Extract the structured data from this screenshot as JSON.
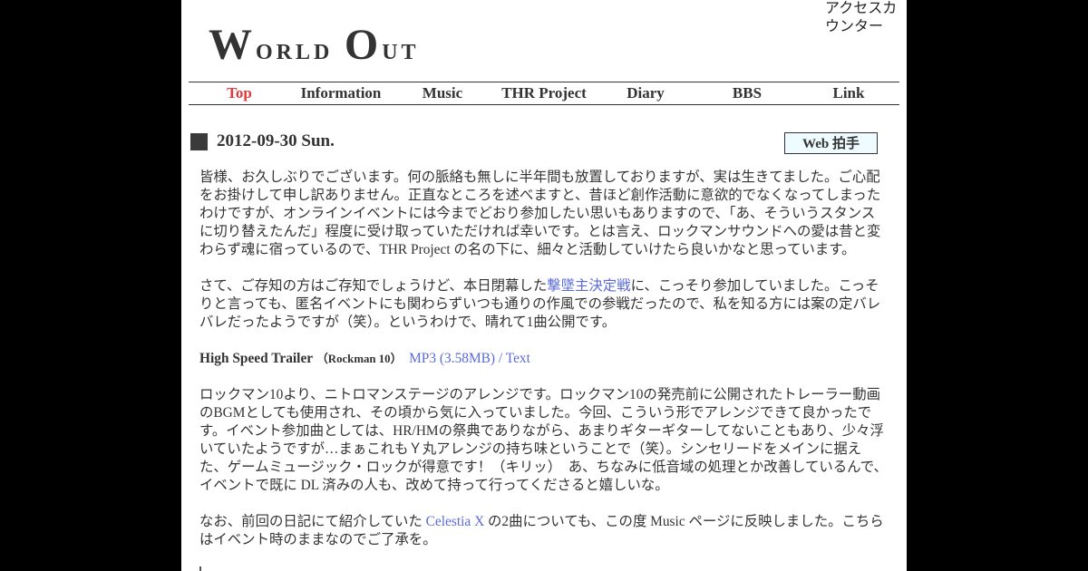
{
  "counter": {
    "alt": "アクセスカウンター"
  },
  "logo": {
    "w": "W",
    "orld": "orld",
    "o": "O",
    "ut": "ut"
  },
  "nav": {
    "items": [
      "Top",
      "Information",
      "Music",
      "THR Project",
      "Diary",
      "BBS",
      "Link"
    ],
    "active": "Top"
  },
  "post": {
    "date": "2012-09-30 Sun.",
    "clap_button": "Web 拍手",
    "p1": "皆様、お久しぶりでございます。何の脈絡も無しに半年間も放置しておりますが、実は生きてました。ご心配をお掛けして申し訳ありません。正直なところを述べますと、昔ほど創作活動に意欲的でなくなってしまったわけですが、オンラインイベントには今までどおり参加したい思いもありますので、「あ、そういうスタンスに切り替えたんだ」程度に受け取っていただければ幸いです。とは言え、ロックマンサウンドへの愛は昔と変わらず魂に宿っているので、THR Project の名の下に、細々と活動していけたら良いかなと思っています。",
    "p2_before": "さて、ご存知の方はご存知でしょうけど、本日閉幕した",
    "p2_link": "撃墜主決定戦",
    "p2_after": "に、こっそり参加していました。こっそりと言っても、匿名イベントにも関わらずいつも通りの作風での参戦だったので、私を知る方には案の定バレバレだったようですが（笑）。というわけで、晴れて1曲公開です。",
    "track_title": "High Speed Trailer",
    "track_sub": "（Rockman 10）",
    "track_links": "MP3 (3.58MB) / Text",
    "p3": "ロックマン10より、ニトロマンステージのアレンジです。ロックマン10の発売前に公開されたトレーラー動画のBGMとしても使用され、その頃から気に入っていました。今回、こういう形でアレンジできて良かったです。イベント参加曲としては、HR/HMの祭典でありながら、あまりギターギターしてないこともあり、少々浮いていたようですが…まぁこれもＹ丸アレンジの持ち味ということで（笑）。シンセリードをメインに据えた、ゲームミュージック・ロックが得意です！（キリッ）　あ、ちなみに低音域の処理とか改善しているんで、イベントで既に DL 済みの人も、改めて持って行ってくださると嬉しいな。",
    "p4_before": "なお、前回の日記にて紹介していた ",
    "p4_link": "Celestia X",
    "p4_after": " の2曲についても、この度 Music ページに反映しました。こちらはイベント時のままなのでご了承を。"
  }
}
